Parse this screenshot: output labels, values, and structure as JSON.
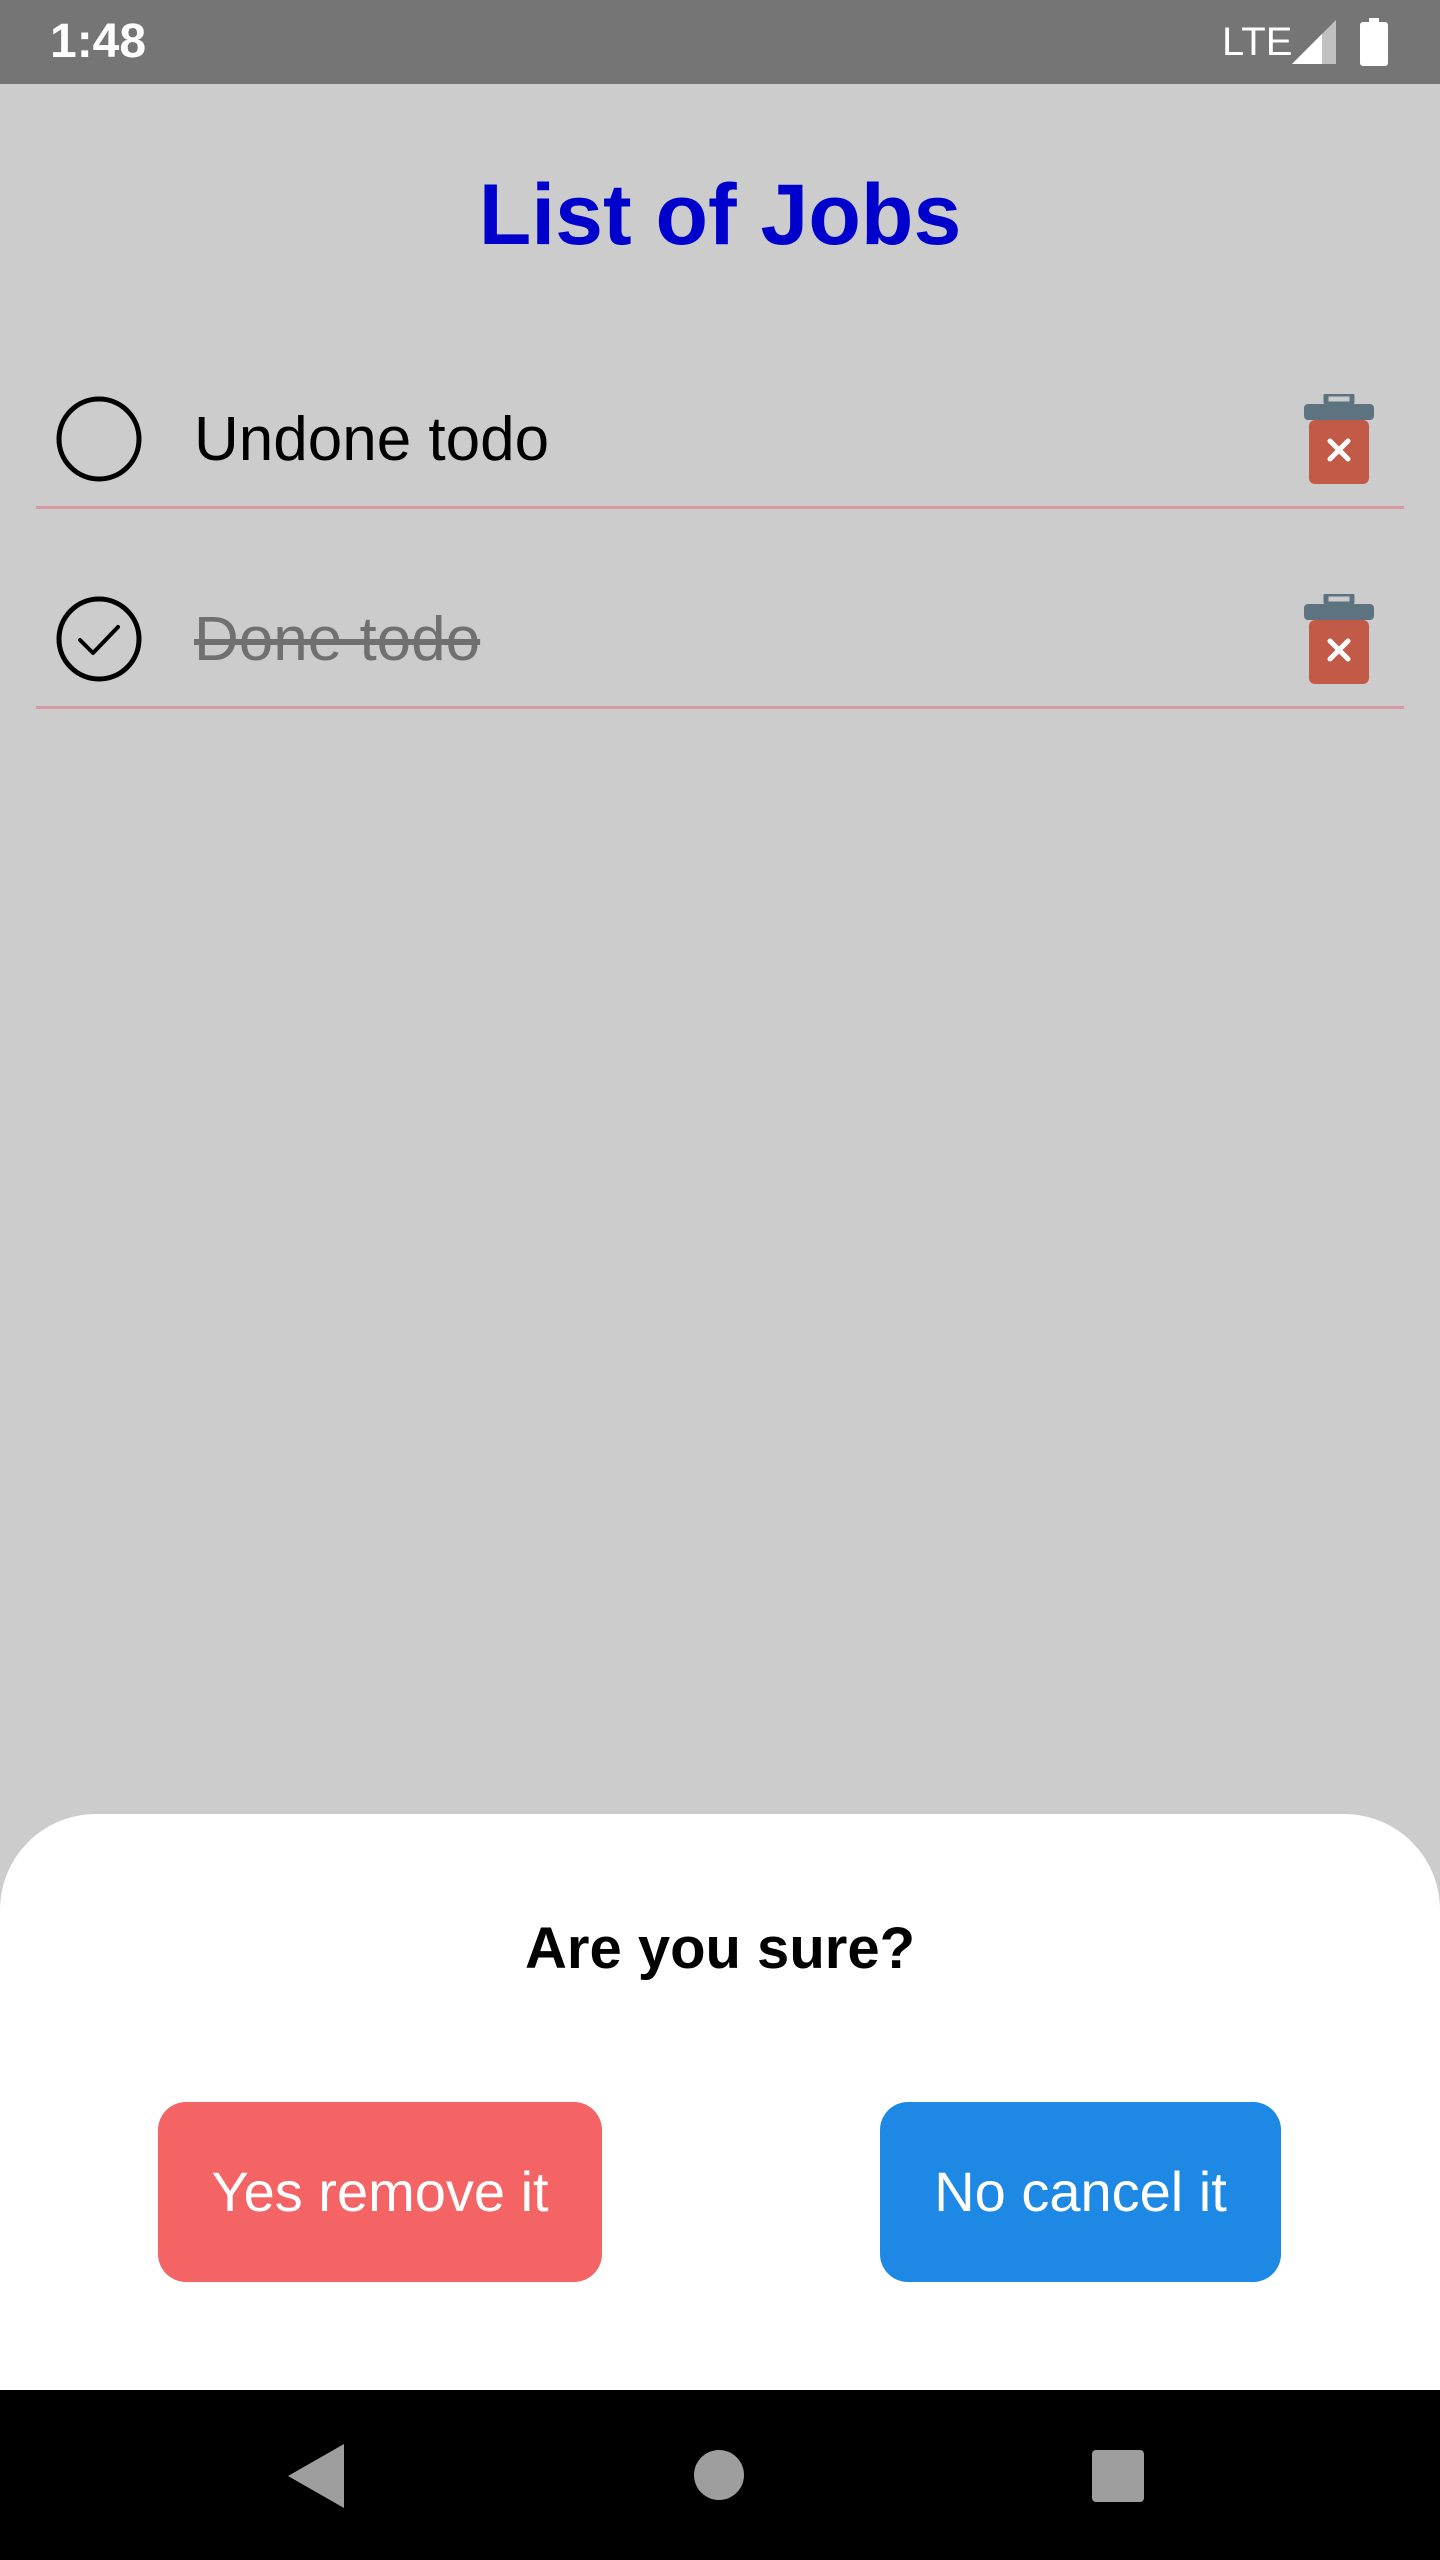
{
  "status_bar": {
    "time": "1:48",
    "network": "LTE",
    "signal_icon": "cell-signal-icon",
    "battery_icon": "battery-icon"
  },
  "app": {
    "title": "List of Jobs",
    "title_color": "#0000cc"
  },
  "todos": [
    {
      "text": "Undone todo",
      "done": false,
      "check_icon": "empty-circle-icon",
      "delete_icon": "trash-delete-icon"
    },
    {
      "text": "Done todo",
      "done": true,
      "check_icon": "check-circle-icon",
      "delete_icon": "trash-delete-icon"
    }
  ],
  "dialog": {
    "title": "Are you sure?",
    "confirm_label": "Yes remove it",
    "cancel_label": "No cancel it",
    "confirm_color": "#f46464",
    "cancel_color": "#1e88e5"
  },
  "nav_bar": {
    "back_icon": "back-triangle-icon",
    "home_icon": "home-circle-icon",
    "recents_icon": "recents-square-icon"
  }
}
